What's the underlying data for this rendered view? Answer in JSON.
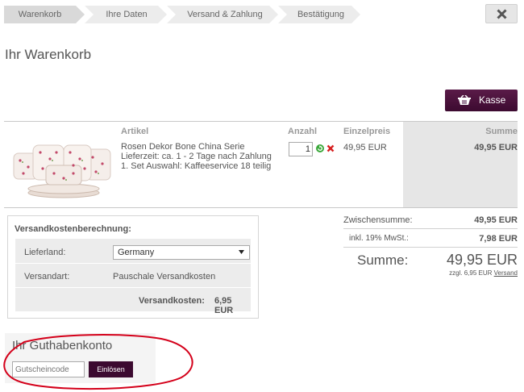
{
  "steps": [
    "Warenkorb",
    "Ihre Daten",
    "Versand & Zahlung",
    "Bestätigung"
  ],
  "page_title": "Ihr Warenkorb",
  "checkout_button": "Kasse",
  "columns": {
    "artikel": "Artikel",
    "anzahl": "Anzahl",
    "einzelpreis": "Einzelpreis",
    "summe": "Summe"
  },
  "item": {
    "name": "Rosen Dekor Bone China Serie",
    "delivery": "Lieferzeit: ca. 1 - 2 Tage nach Zahlung",
    "option": "1. Set Auswahl: Kaffeeservice 18 teilig",
    "quantity": "1",
    "unit_price": "49,95 EUR",
    "total": "49,95 EUR"
  },
  "shipping": {
    "title": "Versandkostenberechnung:",
    "country_label": "Lieferland:",
    "country_value": "Germany",
    "method_label": "Versandart:",
    "method_value": "Pauschale Versandkosten",
    "cost_label": "Versandkosten:",
    "cost_value": "6,95 EUR"
  },
  "totals": {
    "subtotal_label": "Zwischensumme:",
    "subtotal_value": "49,95 EUR",
    "vat_label": "inkl. 19% MwSt.:",
    "vat_value": "7,98 EUR",
    "sum_label": "Summe:",
    "sum_value": "49,95 EUR",
    "shipping_note": "zzgl. 6,95 EUR ",
    "shipping_link": "Versand"
  },
  "voucher": {
    "title": "Ihr Guthabenkonto",
    "placeholder": "Gutscheincode",
    "button": "Einlösen"
  },
  "colors": {
    "accent": "#3c0a30",
    "step_active_bg": "#d9d9d9",
    "step_bg": "#ececec",
    "annotation": "#d4001a"
  }
}
